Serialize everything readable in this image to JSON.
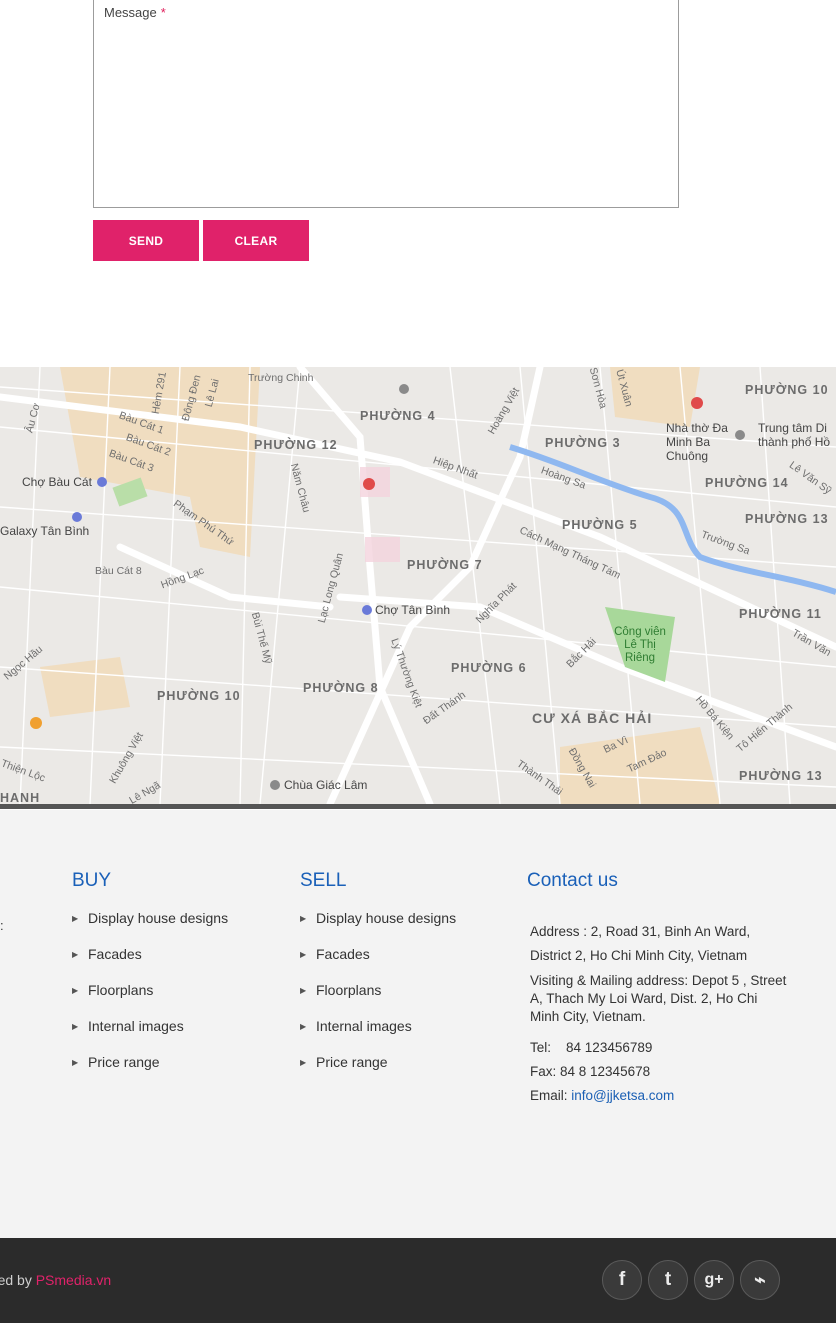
{
  "form": {
    "message_label": "Message",
    "required_mark": "*",
    "send_label": "SEND",
    "clear_label": "CLEAR"
  },
  "map": {
    "districts": [
      "PHƯỜNG 4",
      "PHƯỜNG 12",
      "PHƯỜNG 3",
      "PHƯỜNG 14",
      "PHƯỜNG 10",
      "PHƯỜNG 13",
      "PHƯỜNG 5",
      "PHƯỜNG 7",
      "PHƯỜNG 11",
      "PHƯỜNG 6",
      "PHƯỜNG 8",
      "PHƯỜNG 10",
      "CƯ XÁ BẮC HẢI",
      "PHƯỜNG 13",
      "HANH"
    ],
    "streets": [
      "Trường Chinh",
      "Bàu Cát 1",
      "Bàu Cát 2",
      "Bàu Cát 3",
      "Bàu Cát 8",
      "Hoàng Sa",
      "Trường Sa",
      "Cách Mạng Tháng Tám",
      "Lạc Long Quân",
      "Lý Thường Kiệt",
      "Hiệp Nhất",
      "Nghĩa Phát",
      "Bắc Hải",
      "Tô Hiến Thành",
      "Hồ Bá Kiện",
      "Thành Thái",
      "Đồng Nai",
      "Ba Vì",
      "Tam Đảo",
      "Âu Cơ",
      "Phạm Phú Thứ",
      "Hồng Lạc",
      "Bùi Thế Mỹ",
      "Năm Châu",
      "Đất Thánh",
      "Lê Lai",
      "Hoàng Việt",
      "Sơn Hòa",
      "Út Xuân",
      "Trần Văn",
      "Lê Văn Sỹ",
      "Khuông Việt",
      "Lê Ngã",
      "Thiện Lộc",
      "Ngọc Hầu",
      "Hẻm 291",
      "Đông Đen"
    ],
    "pois": [
      "Chợ Bàu Cát",
      "Galaxy Tân Bình",
      "Chợ Tân Bình",
      "Chùa Giác Lâm",
      "Nhà thờ Đa Minh Ba Chuông",
      "Trung tâm Di thành phố Hồ"
    ],
    "park": "Công viên Lê Thị Riêng",
    "park_color": "#a8d89a",
    "water_color": "#8fb8f0"
  },
  "footer": {
    "buy": {
      "title": "BUY",
      "items": [
        "Display house designs",
        "Facades",
        "Floorplans",
        "Internal images",
        "Price range"
      ]
    },
    "sell": {
      "title": "SELL",
      "items": [
        "Display house designs",
        "Facades",
        "Floorplans",
        "Internal images",
        "Price range"
      ]
    },
    "contact": {
      "title": "Contact us",
      "address": "Address : 2, Road 31, Binh An Ward, District 2, Ho Chi Minh City, Vietnam",
      "mailing": "Visiting & Mailing address: Depot 5 , Street A, Thach My Loi Ward, Dist. 2, Ho Chi Minh City, Vietnam.",
      "tel_label": "Tel:",
      "tel": "84 123456789",
      "fax": "Fax: 84 8 12345678",
      "email_label": "Email:",
      "email": "info@jjketsa.com"
    },
    "clipped_left": ":"
  },
  "bottom": {
    "credit_prefix": "gned by ",
    "brand": "PSmedia.vn",
    "brand_color": "#e0226a",
    "social": [
      "facebook-icon",
      "twitter-icon",
      "google-plus-icon",
      "rss-icon"
    ],
    "social_glyphs": [
      "f",
      "t",
      "g+",
      "⌁"
    ]
  }
}
